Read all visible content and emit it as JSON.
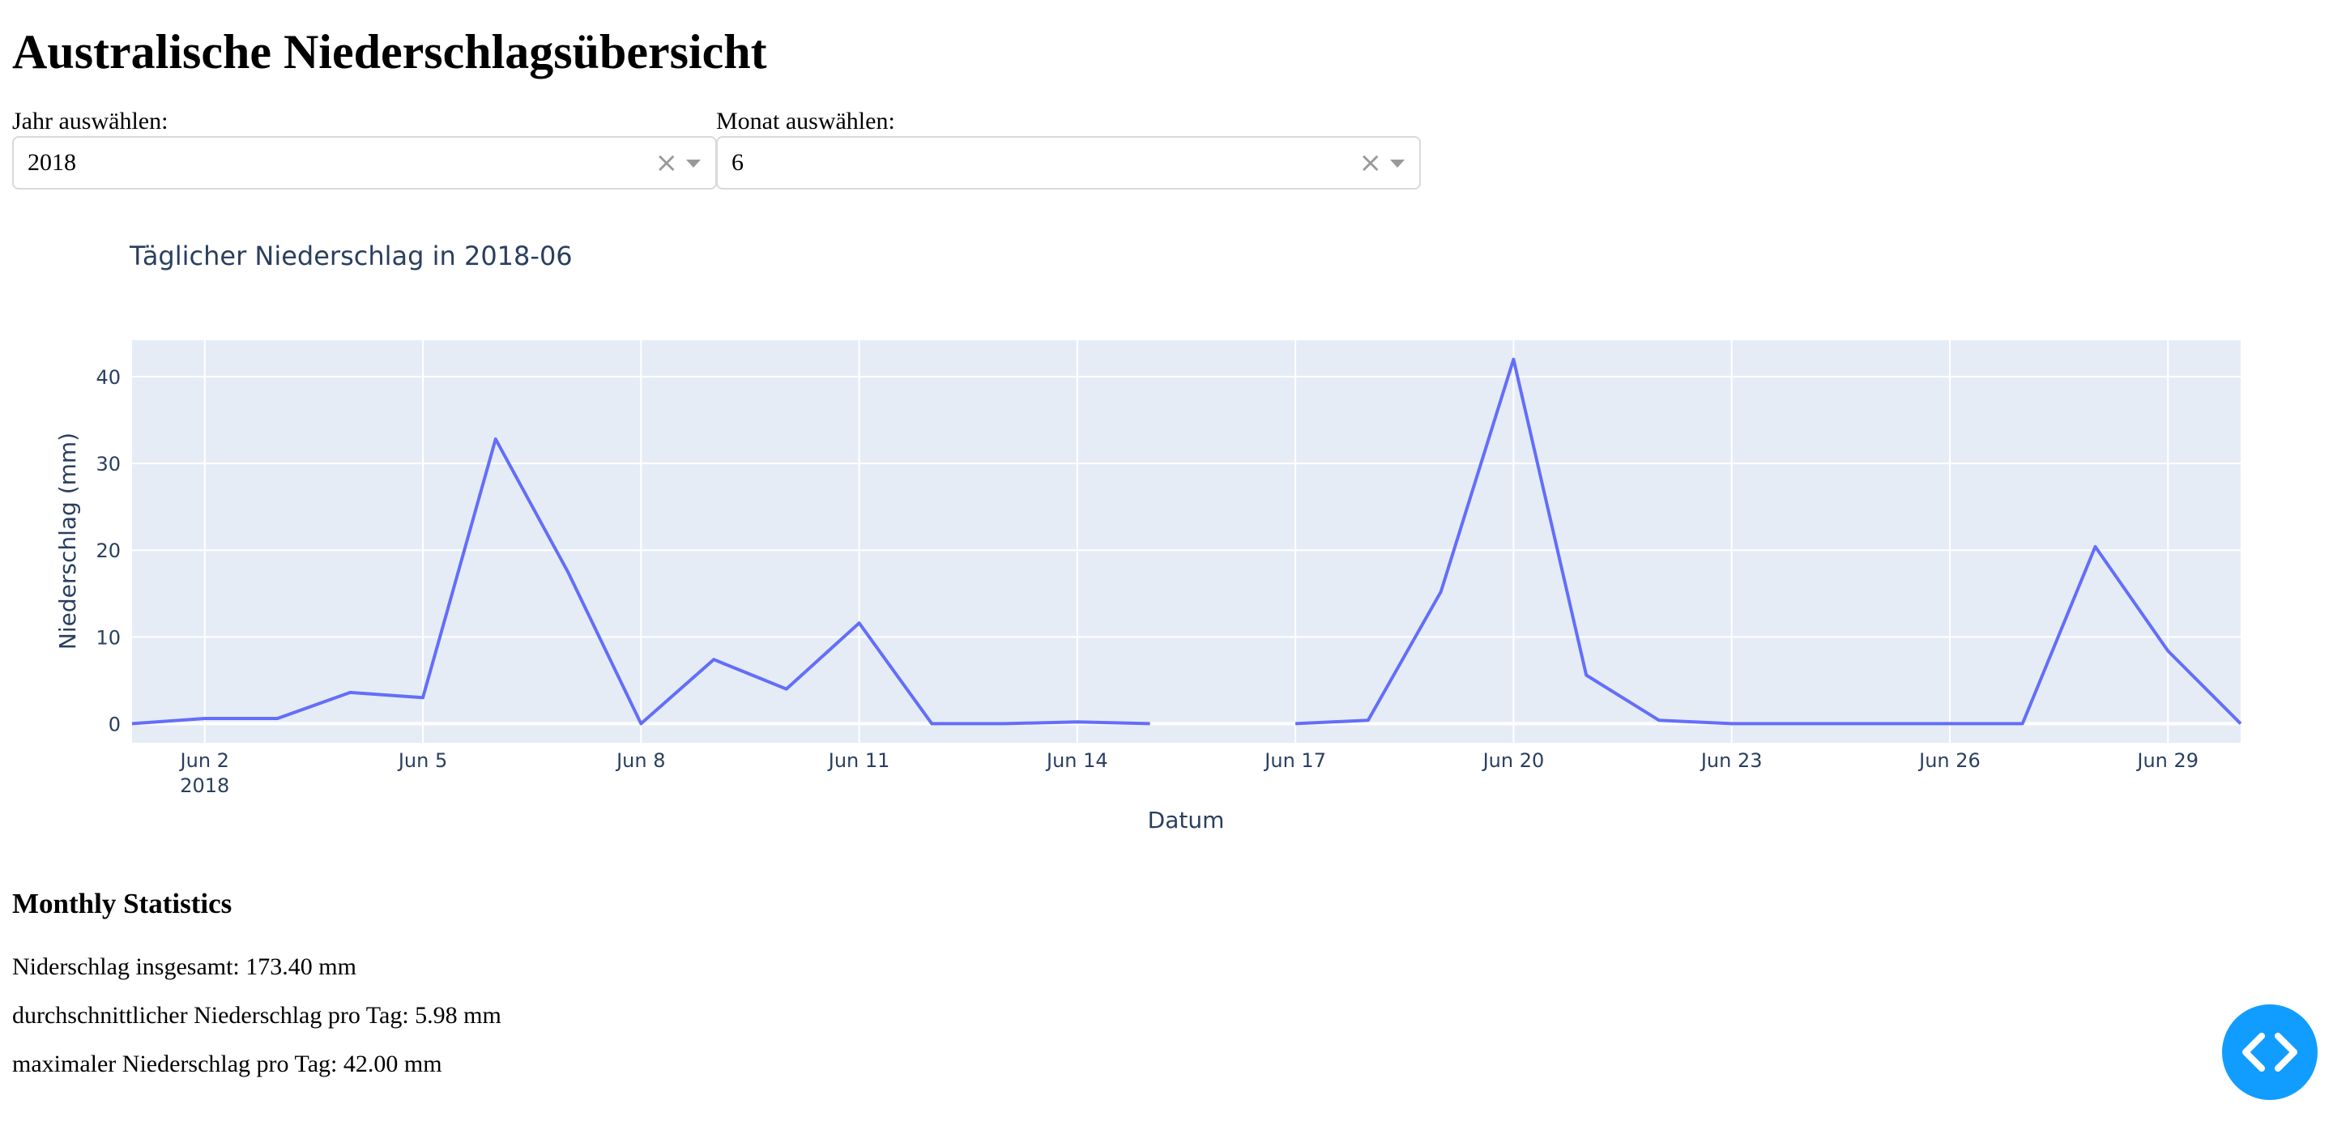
{
  "page": {
    "title": "Australische Niederschlagsübersicht"
  },
  "filters": {
    "year": {
      "label": "Jahr auswählen:",
      "value": "2018",
      "clear_symbol": "×",
      "arrow_icon": "chevron-down-icon"
    },
    "month": {
      "label": "Monat auswählen:",
      "value": "6",
      "clear_symbol": "×",
      "arrow_icon": "chevron-down-icon"
    }
  },
  "chart_data": {
    "type": "line",
    "title": "Täglicher Niederschlag in 2018-06",
    "xlabel": "Datum",
    "ylabel": "Niederschlag (mm)",
    "x": [
      1,
      2,
      3,
      4,
      5,
      6,
      7,
      8,
      9,
      10,
      11,
      12,
      13,
      14,
      15,
      16,
      17,
      18,
      19,
      20,
      21,
      22,
      23,
      24,
      25,
      26,
      27,
      28,
      29,
      30
    ],
    "values": [
      0,
      0.6,
      0.6,
      3.6,
      3,
      32.8,
      17.4,
      0,
      7.4,
      4,
      11.6,
      0,
      0,
      0.2,
      0,
      null,
      0,
      0.4,
      15.2,
      42,
      5.6,
      0.4,
      0,
      0,
      0,
      0,
      0,
      20.4,
      8.4,
      0
    ],
    "xlim": [
      1,
      30
    ],
    "ylim": [
      -2.2,
      44.2
    ],
    "x_ticks": [
      {
        "day": 2,
        "label": "Jun 2",
        "sublabel": "2018"
      },
      {
        "day": 5,
        "label": "Jun 5"
      },
      {
        "day": 8,
        "label": "Jun 8"
      },
      {
        "day": 11,
        "label": "Jun 11"
      },
      {
        "day": 14,
        "label": "Jun 14"
      },
      {
        "day": 17,
        "label": "Jun 17"
      },
      {
        "day": 20,
        "label": "Jun 20"
      },
      {
        "day": 23,
        "label": "Jun 23"
      },
      {
        "day": 26,
        "label": "Jun 26"
      },
      {
        "day": 29,
        "label": "Jun 29"
      }
    ],
    "y_ticks": [
      0,
      10,
      20,
      30,
      40
    ],
    "grid": true,
    "colors": {
      "line": "#636efa",
      "plot_background": "#e5ecf6",
      "grid": "#ffffff",
      "text": "#2a3f5f"
    }
  },
  "stats": {
    "title": "Monthly Statistics",
    "total": "Niderschlag insgesamt: 173.40 mm",
    "average": "durchschnittlicher Niederschlag pro Tag: 5.98 mm",
    "maximum": "maximaler Niederschlag pro Tag: 42.00 mm"
  },
  "devtools": {
    "icon": "code-brackets-icon",
    "color": "#119dff"
  }
}
